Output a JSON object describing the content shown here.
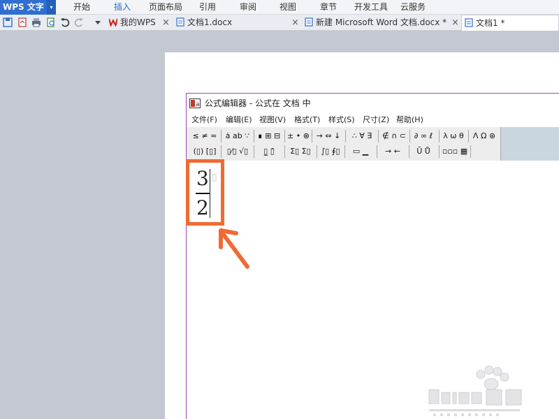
{
  "app": {
    "name": "WPS 文字",
    "dropdown_arrow": "▾"
  },
  "menu_tabs": [
    "开始",
    "插入",
    "页面布局",
    "引用",
    "审阅",
    "视图",
    "章节",
    "开发工具",
    "云服务"
  ],
  "active_menu_tab": "插入",
  "quick_toolbar": {
    "icons": [
      "save-icon",
      "export-pdf-icon",
      "print-icon",
      "print-preview-icon",
      "undo-icon",
      "redo-icon",
      "dropdown-icon"
    ]
  },
  "doc_tabs": {
    "my_wps": "我的WPS",
    "doc1docx": "文档1.docx",
    "new_word": "新建 Microsoft Word 文档.docx *",
    "doc1": "文档1 *",
    "close_glyph": "×"
  },
  "editor": {
    "title": "公式编辑器 - 公式在 文档 中",
    "menu": [
      "文件(F)",
      "编辑(E)",
      "视图(V)",
      "格式(T)",
      "样式(S)",
      "尺寸(Z)",
      "帮助(H)"
    ],
    "palette_row1": [
      "≤ ≠ ≈",
      "ȧ ab ∵",
      "∎ ⊞ ⊟",
      "± • ⊗",
      "→ ⇔ ↓",
      "∴ ∀ ∃",
      "∉ ∩ ⊂",
      "∂ ∞ ℓ",
      "λ ω θ",
      "Λ Ω ⊛"
    ],
    "palette_row2": [
      "(▯) [▯]",
      "▯⁄▯ √▯",
      "▯̲ ▯̄",
      "Σ▯ Σ▯",
      "∫▯ ∮▯",
      "▭ ▁",
      "→ ←",
      "Ū Ů",
      "▫▫▫ ▦"
    ]
  },
  "fraction": {
    "numerator": "3",
    "denominator": "2"
  },
  "colors": {
    "highlight": "#f16a33",
    "editor_border": "#9b4ab0",
    "app_blue": "#2f6fcf"
  }
}
